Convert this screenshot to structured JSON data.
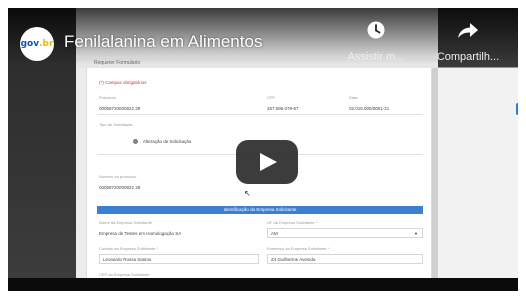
{
  "video": {
    "title": "Fenilalanina em Alimentos",
    "channel_logo": {
      "text_part1": "gov",
      "text_part2": ".br",
      "colors": [
        "#1351b4",
        "#f0b800"
      ]
    },
    "controls": [
      {
        "icon": "clock-icon",
        "label": "Assistir m..."
      },
      {
        "icon": "share-icon",
        "label": "Compartilh..."
      }
    ],
    "play_button": {
      "icon": "play-icon"
    }
  },
  "screen": {
    "tab_text": "Requerer Formulario",
    "required_note": "(*) Campos obrigatórios",
    "row1": [
      {
        "label": "Protocolo",
        "value": "00068720000822 29"
      },
      {
        "label": "CPF",
        "value": "257.596.079-67"
      },
      {
        "label": "Data",
        "value": "02.015.000/0001-21"
      }
    ],
    "request_type_label": "Tipo de Solicitação",
    "request_type_option": "Alteração de Solicitação",
    "protocol_number_label": "Número do protocolo",
    "protocol_number_value": "00068720000822 29",
    "section_title": "Identificação da Empresa Solicitante",
    "company_name_label": "Nome da Empresa Solicitante",
    "company_name_value": "Empresa de Testes em Homologação SA",
    "uf_label": "UF da Empresa Solicitante *",
    "uf_value": "AM",
    "contact_label": "Contato da Empresa Solicitante *",
    "contact_value": "Leonardo Rossa Santos",
    "address_label": "Endereço da Empresa Solicitante *",
    "address_value": "Z4 Guilherme Avenida",
    "next_label": "CEP da Empresa Solicitante",
    "side_badge": "S"
  }
}
